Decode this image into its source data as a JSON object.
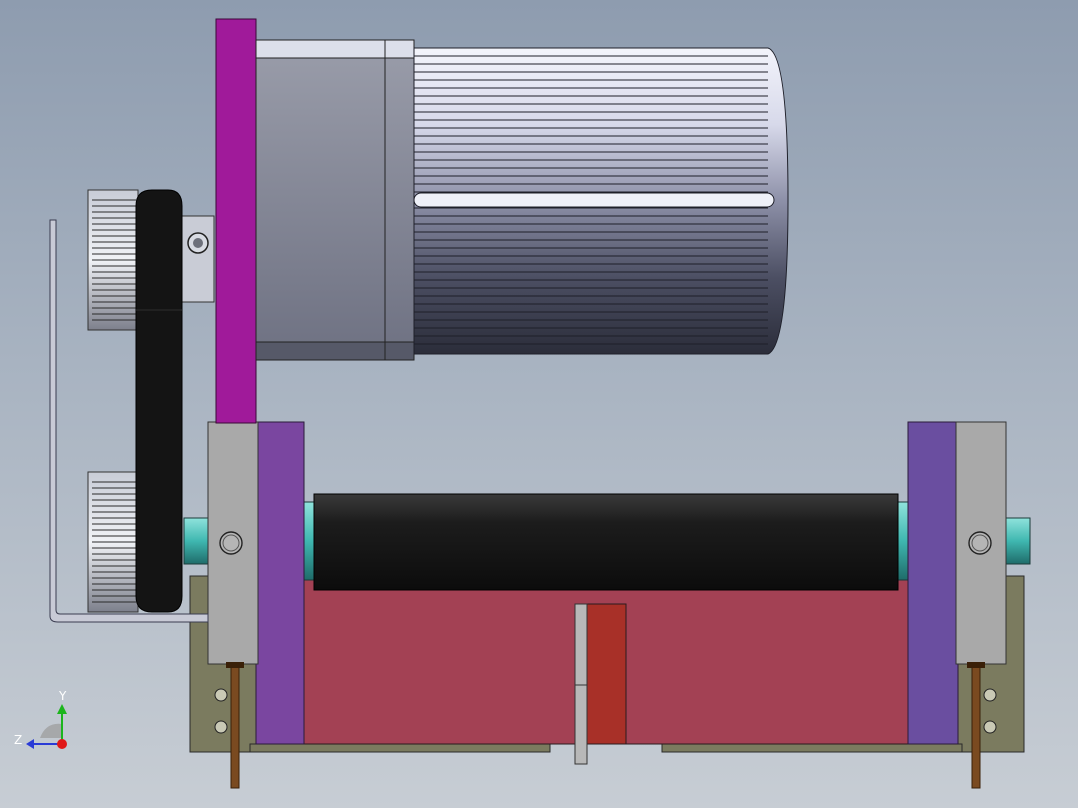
{
  "viewport": {
    "background_top": "#8e9caf",
    "background_bottom": "#c7cdd4"
  },
  "triad": {
    "y_label": "Y",
    "z_label": "Z",
    "y_color": "#1cb51c",
    "z_color": "#2a3bd6",
    "x_color": "#e01818"
  },
  "colors": {
    "motor_bracket": "#a01a9a",
    "side_plate": "#7a46a0",
    "bearing_block": "#a9a9a9",
    "roller": "#1a1a1a",
    "tray": "#a34154",
    "center_block": "#a83028",
    "base_plate": "#7b7b5f",
    "shaft_end": "#3fb7b0",
    "rod": "#7a4a20",
    "belt": "#141414"
  }
}
